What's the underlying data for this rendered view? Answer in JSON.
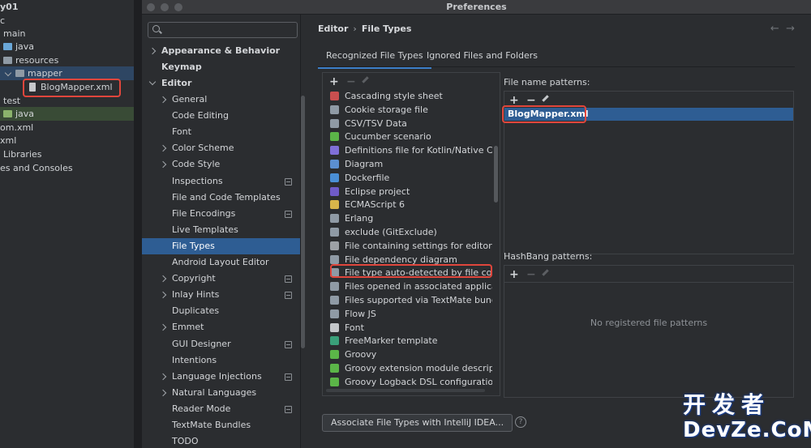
{
  "project_tree": {
    "rows": [
      "y01",
      "c",
      "main",
      "java",
      "resources",
      "mapper",
      "BlogMapper.xml",
      "test",
      "java",
      "om.xml",
      "xml",
      "Libraries",
      "es and Consoles"
    ]
  },
  "window": {
    "title": "Preferences"
  },
  "search": {
    "placeholder": ""
  },
  "sidebar": {
    "items": [
      "Appearance & Behavior",
      "Keymap",
      "Editor",
      "General",
      "Code Editing",
      "Font",
      "Color Scheme",
      "Code Style",
      "Inspections",
      "File and Code Templates",
      "File Encodings",
      "Live Templates",
      "File Types",
      "Android Layout Editor",
      "Copyright",
      "Inlay Hints",
      "Duplicates",
      "Emmet",
      "GUI Designer",
      "Intentions",
      "Language Injections",
      "Natural Languages",
      "Reader Mode",
      "TextMate Bundles",
      "TODO"
    ]
  },
  "breadcrumb": {
    "parent": "Editor",
    "separator": "›",
    "current": "File Types"
  },
  "nav_arrows": {
    "back": "←",
    "forward": "→"
  },
  "tabs": [
    "Recognized File Types",
    "Ignored Files and Folders"
  ],
  "toolbar": {
    "add": "+",
    "remove": "−"
  },
  "file_types": [
    "Cascading style sheet",
    "Cookie storage file",
    "CSV/TSV Data",
    "Cucumber scenario",
    "Definitions file for Kotlin/Native C in",
    "Diagram",
    "Dockerfile",
    "Eclipse project",
    "ECMAScript 6",
    "Erlang",
    "exclude (GitExclude)",
    "File containing settings for editor",
    "File dependency diagram",
    "File type auto-detected by file cont",
    "Files opened in associated applicat",
    "Files supported via TextMate bundl",
    "Flow JS",
    "Font",
    "FreeMarker template",
    "Groovy",
    "Groovy extension module descripto",
    "Groovy Logback DSL configuration"
  ],
  "file_type_icon_colors": [
    "#c94f4f",
    "#8f9aa5",
    "#8f9aa5",
    "#5bb548",
    "#7f6fd8",
    "#5b8fd0",
    "#4a8fd6",
    "#6f5bc9",
    "#d8b54a",
    "#8f9aa5",
    "#8f9aa5",
    "#9da1a6",
    "#8f9aa5",
    "#8f9aa5",
    "#8f9aa5",
    "#8f9aa5",
    "#8f9aa5",
    "#c4c7ca",
    "#3aa07a",
    "#5bb548",
    "#5bb548",
    "#5bb548"
  ],
  "file_name_patterns": {
    "label": "File name patterns:",
    "items": [
      "BlogMapper.xml"
    ]
  },
  "hashbang_patterns": {
    "label": "HashBang patterns:",
    "empty_text": "No registered file patterns"
  },
  "associate_button": "Associate File Types with IntelliJ IDEA...",
  "help": "?",
  "watermark": {
    "line1": "开发者",
    "line2": "DevZe.CoM"
  }
}
